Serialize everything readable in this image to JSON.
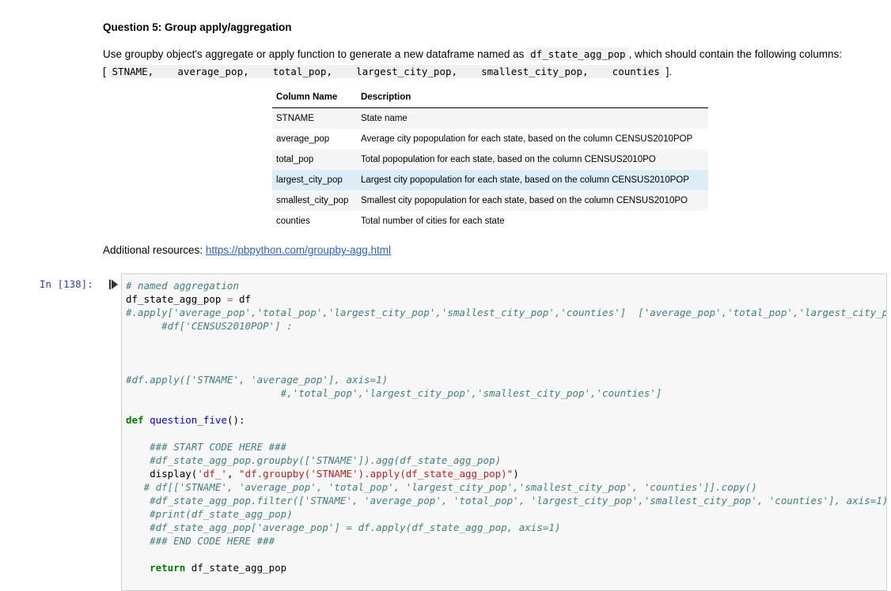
{
  "question_title": "Question 5: Group apply/aggregation",
  "description": {
    "text_before": "Use groupby object's aggregate or apply function to generate a new dataframe named as ",
    "df_name": "df_state_agg_pop",
    "text_after": ", which should contain the following columns:",
    "open_bracket": "[",
    "columns_code": "STNAME,    average_pop,    total_pop,    largest_city_pop,    smallest_city_pop,    counties",
    "close_bracket": "]."
  },
  "table": {
    "headers": [
      "Column Name",
      "Description"
    ],
    "rows": [
      [
        "STNAME",
        "State name"
      ],
      [
        "average_pop",
        "Average city popopulation for each state, based on the column CENSUS2010POP"
      ],
      [
        "total_pop",
        "Total popopulation for each state, based on the column CENSUS2010PO"
      ],
      [
        "largest_city_pop",
        "Largest city popopulation for each state, based on the column CENSUS2010POP"
      ],
      [
        "smallest_city_pop",
        "Smallest city popopulation for each state, based on the column CENSUS2010PO"
      ],
      [
        "counties",
        "Total number of cities for each state"
      ]
    ]
  },
  "resources": {
    "label": "Additional resources: ",
    "link_text": "https://pbpython.com/groupby-agg.html"
  },
  "cell": {
    "prompt": "In [138]:",
    "lines": {
      "l1": "# named aggregation",
      "l2a": "df_state_agg_pop ",
      "l2b": "=",
      "l2c": " df",
      "l3": "#.apply['average_pop','total_pop','largest_city_pop','smallest_city_pop','counties']  ['average_pop','total_pop','largest_city_pop','smallest_city_pop','counties']",
      "l4": "      #df['CENSUS2010POP'] :",
      "l5": "#df.apply(['STNAME', 'average_pop'], axis=1)",
      "l6": "                          #,'total_pop','largest_city_pop','smallest_city_pop','counties']",
      "l7_kw": "def",
      "l7_fn": "question_five",
      "l7_rest": "():",
      "l8": "    ### START CODE HERE ###",
      "l9": "    #df_state_agg_pop.groupby(['STNAME']).agg(df_state_agg_pop)",
      "l10a": "    display(",
      "l10b": "'df_'",
      "l10c": ", ",
      "l10d": "\"df.groupby('STNAME').apply(df_state_agg_pop)\"",
      "l10e": ")",
      "l11": "   # df[['STNAME', 'average_pop', 'total_pop', 'largest_city_pop','smallest_city_pop', 'counties']].copy()",
      "l12": "    #df_state_agg_pop.filter(['STNAME', 'average_pop', 'total_pop', 'largest_city_pop','smallest_city_pop', 'counties'], axis=1)",
      "l13": "    #print(df_state_agg_pop)",
      "l14": "    #df_state_agg_pop['average_pop'] = df.apply(df_state_agg_pop, axis=1)",
      "l15": "    ### END CODE HERE ###",
      "l16_indent": "    ",
      "l16_kw": "return",
      "l16_rest": " df_state_agg_pop"
    }
  }
}
